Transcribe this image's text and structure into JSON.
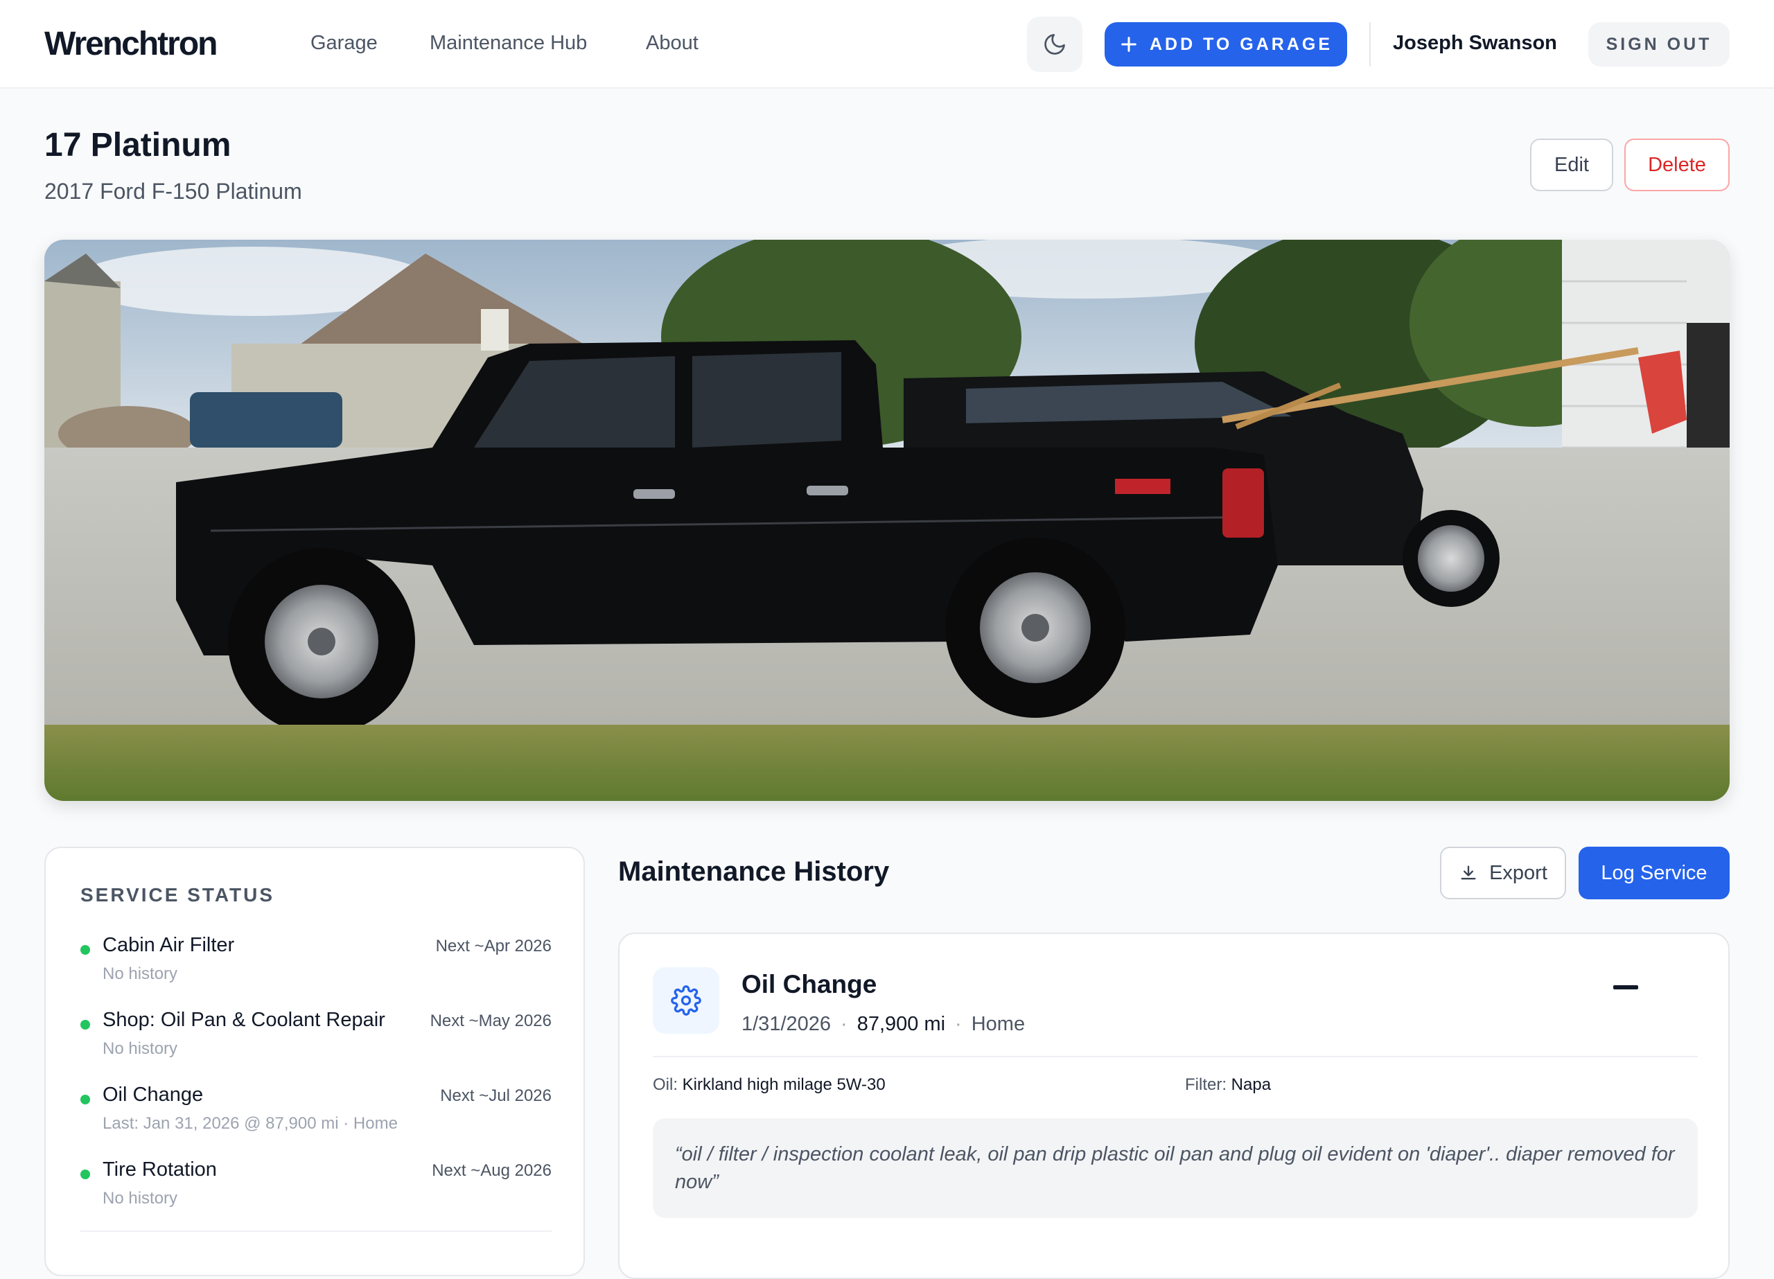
{
  "header": {
    "logo": "Wrenchtron",
    "nav": [
      "Garage",
      "Maintenance Hub",
      "About"
    ],
    "theme_icon": "moon-icon",
    "add_button_label": "ADD TO GARAGE",
    "user_name": "Joseph Swanson",
    "signout_label": "SIGN OUT"
  },
  "vehicle": {
    "nickname": "17 Platinum",
    "description": "2017 Ford F-150 Platinum",
    "edit_label": "Edit",
    "delete_label": "Delete",
    "photo": "black pickup truck in driveway"
  },
  "service_status": {
    "heading": "SERVICE STATUS",
    "items": [
      {
        "name": "Cabin Air Filter",
        "next": "Next ~Apr 2026",
        "sub": "No history",
        "status_color": "#22c55e"
      },
      {
        "name": "Shop: Oil Pan & Coolant Repair",
        "next": "Next ~May 2026",
        "sub": "No history",
        "status_color": "#22c55e"
      },
      {
        "name": "Oil Change",
        "next": "Next ~Jul 2026",
        "sub": "Last: Jan 31, 2026 @ 87,900 mi · Home",
        "status_color": "#22c55e"
      },
      {
        "name": "Tire Rotation",
        "next": "Next ~Aug 2026",
        "sub": "No history",
        "status_color": "#22c55e"
      }
    ]
  },
  "maintenance_history": {
    "title": "Maintenance History",
    "export_label": "Export",
    "log_label": "Log Service",
    "entries": [
      {
        "icon": "gear-icon",
        "type": "Oil Change",
        "date": "1/31/2026",
        "mileage": "87,900 mi",
        "location": "Home",
        "oil_label": "Oil:",
        "oil_value": "Kirkland high milage 5W-30",
        "filter_label": "Filter:",
        "filter_value": "Napa",
        "note": "“oil / filter / inspection coolant leak, oil pan drip plastic oil pan and plug oil evident on 'diaper'.. diaper removed for now”"
      }
    ]
  },
  "colors": {
    "accent": "#2563eb",
    "danger": "#dc2626",
    "ok": "#22c55e"
  }
}
